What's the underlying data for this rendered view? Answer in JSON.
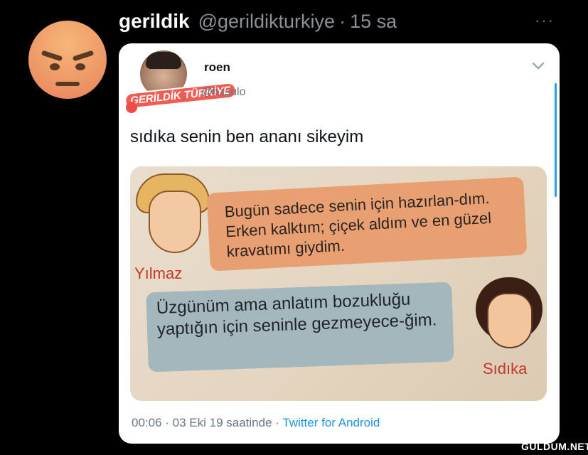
{
  "outer_tweet": {
    "name": "gerildik",
    "handle": "@gerildikturkiye",
    "separator": "·",
    "time": "15 sa",
    "more": "···"
  },
  "embedded": {
    "name": "roen",
    "handle": "@hzsulo",
    "logo_text": "GERİLDİK TÜRKİYE",
    "text": "sıdıka senin ben ananı sikeyim",
    "comic": {
      "label_left": "Yılmaz",
      "bubble_top": "Bugün sadece senin için hazırlan-dım. Erken kalktım; çiçek aldım ve en güzel kravatımı giydim.",
      "bubble_bottom": "Üzgünüm ama anlatım bozukluğu yaptığın için seninle gezmeyece-ğim.",
      "label_right": "Sıdıka"
    },
    "meta": {
      "time_date": "00:06 · 03 Eki 19 saatinde · ",
      "app": "Twitter for Android"
    }
  },
  "watermark": "GÜLDUM.NET",
  "colors": {
    "background": "#000000",
    "link": "#1b95e0",
    "muted": "#8b9197"
  }
}
